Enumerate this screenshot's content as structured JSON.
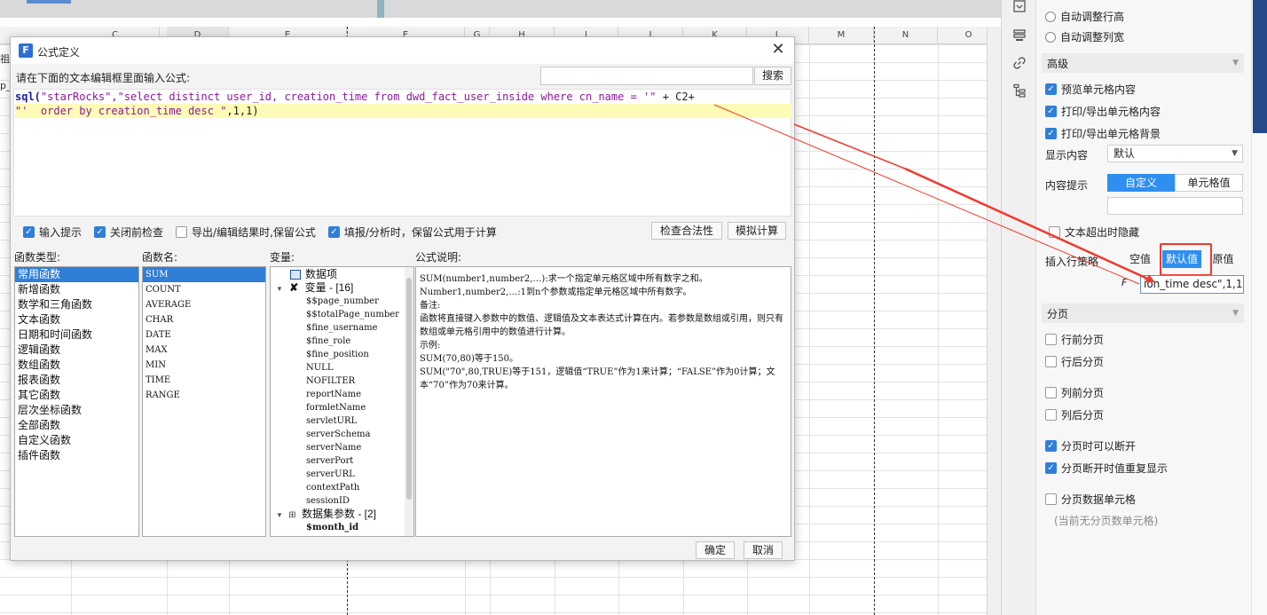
{
  "sheet": {
    "columns": [
      "C",
      "D",
      "E",
      "E",
      "G",
      "H",
      "I",
      "J",
      "K",
      "L",
      "M",
      "N",
      "O"
    ],
    "left_labels": [
      "祖",
      "p_"
    ]
  },
  "panel": {
    "auto_row_height": "自动调整行高",
    "auto_col_width": "自动调整列宽",
    "advanced_title": "高级",
    "preview_content": "预览单元格内容",
    "print_content": "打印/导出单元格内容",
    "print_background": "打印/导出单元格背景",
    "display_label": "显示内容",
    "display_value": "默认",
    "content_hint_label": "内容提示",
    "hint_custom": "自定义",
    "hint_cell_value": "单元格值",
    "overflow_hide": "文本超出时隐藏",
    "insert_policy_label": "插入行策略",
    "insert_empty": "空值",
    "insert_default": "默认值",
    "insert_original": "原值",
    "fx_label": "F",
    "formula_preview": "ion_time desc\",1,1)",
    "paging_title": "分页",
    "page_before_row": "行前分页",
    "page_after_row": "行后分页",
    "page_before_col": "列前分页",
    "page_after_col": "列后分页",
    "page_breakable": "分页时可以断开",
    "page_repeat": "分页断开时值重复显示",
    "page_data_cell": "分页数据单元格",
    "page_data_note": "(当前无分页数单元格)"
  },
  "dialog": {
    "title": "公式定义",
    "logo_letter": "F",
    "instruction": "请在下面的文本编辑框里面输入公式:",
    "search_button": "搜索",
    "code": {
      "line1_fn": "sql(",
      "line1_str": "\"starRocks\",\"select distinct user_id, creation_time from dwd_fact_user_inside where cn_name = '\"",
      "line1_op": " + C2+",
      "line2_str": "\"'  order by creation_time desc \"",
      "line2_op": ",1,1)"
    },
    "options": {
      "input_hint": "输入提示",
      "check_before_close": "关闭前检查",
      "keep_formula_export": "导出/编辑结果时,保留公式",
      "keep_formula_fill": "填报/分析时，保留公式用于计算"
    },
    "check_button": "检查合法性",
    "simulate_button": "模拟计算",
    "function_type_label": "函数类型:",
    "function_name_label": "函数名:",
    "variable_label": "变量:",
    "description_label": "公式说明:",
    "function_types": [
      "常用函数",
      "新增函数",
      "数学和三角函数",
      "文本函数",
      "日期和时间函数",
      "逻辑函数",
      "数组函数",
      "报表函数",
      "其它函数",
      "层次坐标函数",
      "全部函数",
      "自定义函数",
      "插件函数"
    ],
    "function_names": [
      "SUM",
      "COUNT",
      "AVERAGE",
      "CHAR",
      "DATE",
      "MAX",
      "MIN",
      "TIME",
      "RANGE"
    ],
    "variables": {
      "data_item": "数据项",
      "var_group": "变量 - [16]",
      "var_items": [
        "$$page_number",
        "$$totalPage_number",
        "$fine_username",
        "$fine_role",
        "$fine_position",
        "NULL",
        "NOFILTER",
        "reportName",
        "formletName",
        "servletURL",
        "serverSchema",
        "serverName",
        "serverPort",
        "serverURL",
        "contextPath",
        "sessionID"
      ],
      "dataset_group": "数据集参数 - [2]",
      "dataset_items": [
        "$month_id"
      ]
    },
    "description_lines": [
      "SUM(number1,number2,…):求一个指定单元格区域中所有数字之和。",
      "Number1,number2,…:1到n个参数或指定单元格区域中所有数字。",
      "备注:",
      "函数将直接键入参数中的数值、逻辑值及文本表达式计算在内。若参数是数组或引用，则只有数组或单元格引用中的数值进行计算。",
      "示例:",
      "SUM(70,80)等于150。",
      "SUM(\"70\",80,TRUE)等于151，逻辑值“TRUE”作为1来计算；“FALSE”作为0计算；文本“70”作为70来计算。"
    ],
    "ok_button": "确定",
    "cancel_button": "取消"
  },
  "colors": {
    "accent": "#2f7fd8",
    "segment_active": "#2f8ff0",
    "annotation_red": "#ef3a2e",
    "code_highlight": "#fdfbb6"
  }
}
